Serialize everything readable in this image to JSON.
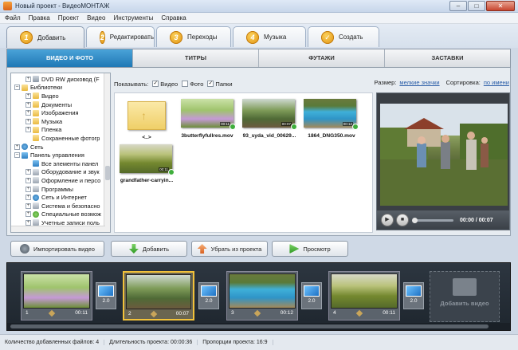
{
  "window": {
    "title": "Новый проект - ВидеоМОНТАЖ",
    "controls": {
      "minimize": "–",
      "maximize": "□",
      "close": "✕"
    }
  },
  "menu": [
    "Файл",
    "Правка",
    "Проект",
    "Видео",
    "Инструменты",
    "Справка"
  ],
  "steps": [
    {
      "num": "1",
      "label": "Добавить",
      "active": true
    },
    {
      "num": "2",
      "label": "Редактировать",
      "active": false
    },
    {
      "num": "3",
      "label": "Переходы",
      "active": false
    },
    {
      "num": "4",
      "label": "Музыка",
      "active": false
    },
    {
      "num": "✓",
      "label": "Создать",
      "active": false
    }
  ],
  "subtabs": [
    {
      "label": "ВИДЕО И ФОТО",
      "active": true
    },
    {
      "label": "ТИТРЫ",
      "active": false
    },
    {
      "label": "ФУТАЖИ",
      "active": false
    },
    {
      "label": "ЗАСТАВКИ",
      "active": false
    }
  ],
  "tree": [
    {
      "label": "DVD RW дисковод (F",
      "icon": "drive-icon"
    },
    {
      "label": "Библиотеки",
      "icon": "folder-icon"
    },
    {
      "label": "Видео",
      "icon": "folder-icon"
    },
    {
      "label": "Документы",
      "icon": "folder-icon"
    },
    {
      "label": "Изображения",
      "icon": "folder-icon"
    },
    {
      "label": "Музыка",
      "icon": "folder-icon"
    },
    {
      "label": "Пленка",
      "icon": "folder-icon"
    },
    {
      "label": "Сохраненные фотогр",
      "icon": "folder-icon"
    },
    {
      "label": "Сеть",
      "icon": "network-icon"
    },
    {
      "label": "Панель управления",
      "icon": "control-panel-icon"
    },
    {
      "label": "Все элементы панел",
      "icon": "control-panel-icon"
    },
    {
      "label": "Оборудование и звук",
      "icon": "gray-icon"
    },
    {
      "label": "Оформление и персо",
      "icon": "gray-icon"
    },
    {
      "label": "Программы",
      "icon": "gray-icon"
    },
    {
      "label": "Сеть и Интернет",
      "icon": "network-icon"
    },
    {
      "label": "Система и безопасно",
      "icon": "gray-icon"
    },
    {
      "label": "Специальные возмож",
      "icon": "green-icon"
    },
    {
      "label": "Учетные записи поль",
      "icon": "gray-icon"
    }
  ],
  "filter": {
    "show_label": "Показывать:",
    "video": "Видео",
    "photo": "Фото",
    "folders": "Папки",
    "video_checked": "✓",
    "photo_checked": "",
    "folders_checked": "✓",
    "size_label": "Размер:",
    "size_value": "мелкие значки",
    "sort_label": "Сортировка:",
    "sort_value": "по имени"
  },
  "files": [
    {
      "name": "<..>",
      "type": "folder"
    },
    {
      "name": "3butterflyfullres.mov",
      "duration": "00:11",
      "type": "video"
    },
    {
      "name": "93_syda_vid_00629...",
      "duration": "00:07",
      "type": "video"
    },
    {
      "name": "1864_DNG350.mov",
      "duration": "00:12",
      "type": "video"
    },
    {
      "name": "grandfather-carryin...",
      "duration": "00:11",
      "type": "video"
    }
  ],
  "preview": {
    "time": "00:00 / 00:07",
    "play_icon": "▶",
    "stop_icon": "■"
  },
  "buttons": {
    "import": "Импортировать видео",
    "add": "Добавить",
    "remove": "Убрать из проекта",
    "preview": "Просмотр"
  },
  "timeline": {
    "clips": [
      {
        "index": "1",
        "duration": "00:11"
      },
      {
        "index": "2",
        "duration": "00:07"
      },
      {
        "index": "3",
        "duration": "00:12"
      },
      {
        "index": "4",
        "duration": "00:11"
      }
    ],
    "transitions": [
      "2.0",
      "2.0",
      "2.0",
      "2.0"
    ],
    "add_video": "Добавить видео"
  },
  "status": {
    "count": "Количество добавленных файлов: 4",
    "duration": "Длительность проекта: 00:00:36",
    "ratio": "Пропорции проекта: 16:9"
  },
  "colors": {
    "accent_tab": "#2a86c4",
    "selected_clip": "#f2c23a",
    "step_badge": "#e9a01c"
  }
}
